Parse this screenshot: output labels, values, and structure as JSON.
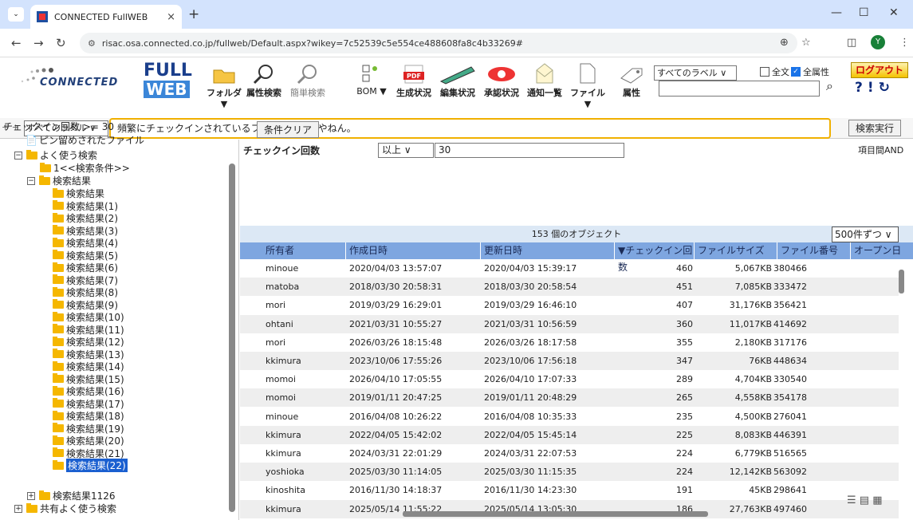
{
  "browser": {
    "tab_title": "CONNECTED FullWEB",
    "tab_close": "×",
    "new_tab": "+",
    "url": "risac.osa.connected.co.jp/fullweb/Default.aspx?wikey=7c52539c5e554ce488608fa8c4b33269#",
    "profile_initial": "Y"
  },
  "logo": {
    "brand": "CONNECTED",
    "full": "FULL",
    "web": "WEB"
  },
  "toolbar": {
    "folder": "フォルダ▼",
    "attr_search": "属性検索",
    "simple_search": "簡単検索",
    "bom": "BOM ▼",
    "gen_status": "生成状況",
    "edit_status": "編集状況",
    "approve_status": "承認状況",
    "notify_list": "通知一覧",
    "file": "ファイル ▼",
    "attr": "属性",
    "label_select": "すべてのラベル ∨",
    "fulltext": "全文",
    "all_attr": "全属性",
    "logout": "ログアウト"
  },
  "query": {
    "plus": "+ +",
    "label_select": "すべてのラベル ∨",
    "text": "頻繁にチェックインされているファイルはどれやねん。"
  },
  "left": {
    "criteria": "チェックイン回数 >= 30",
    "pinned": "ピン留めされたファイル",
    "favorites": "よく使う検索",
    "search_cond": "1<<検索条件>>",
    "results_root": "検索結果",
    "results": [
      "検索結果",
      "検索結果(1)",
      "検索結果(2)",
      "検索結果(3)",
      "検索結果(4)",
      "検索結果(5)",
      "検索結果(6)",
      "検索結果(7)",
      "検索結果(8)",
      "検索結果(9)",
      "検索結果(10)",
      "検索結果(11)",
      "検索結果(12)",
      "検索結果(13)",
      "検索結果(14)",
      "検索結果(15)",
      "検索結果(16)",
      "検索結果(17)",
      "検索結果(18)",
      "検索結果(19)",
      "検索結果(20)",
      "検索結果(21)",
      "検索結果(22)"
    ],
    "results1126": "検索結果1126",
    "shared": "共有よく使う検索"
  },
  "conditions": {
    "clear": "条件クリア",
    "execute": "検索実行",
    "label": "チェックイン回数",
    "operator": "以上 ∨",
    "value": "30",
    "and_label": "項目間AND"
  },
  "table": {
    "object_count": "153 個のオブジェクト",
    "per_page": "500件ずつ ∨",
    "headers": [
      "所有者",
      "作成日時",
      "更新日時",
      "▼チェックイン回数",
      "ファイルサイズ",
      "ファイル番号",
      "オープン日"
    ],
    "rows": [
      [
        "minoue",
        "2020/04/03 13:57:07",
        "2020/04/03 15:39:17",
        "460",
        "5,067KB",
        "380466"
      ],
      [
        "matoba",
        "2018/03/30 20:58:31",
        "2018/03/30 20:58:54",
        "451",
        "7,085KB",
        "333472"
      ],
      [
        "mori",
        "2019/03/29 16:29:01",
        "2019/03/29 16:46:10",
        "407",
        "31,176KB",
        "356421"
      ],
      [
        "ohtani",
        "2021/03/31 10:55:27",
        "2021/03/31 10:56:59",
        "360",
        "11,017KB",
        "414692"
      ],
      [
        "mori",
        "2026/03/26 18:15:48",
        "2026/03/26 18:17:58",
        "355",
        "2,180KB",
        "317176"
      ],
      [
        "kkimura",
        "2023/10/06 17:55:26",
        "2023/10/06 17:56:18",
        "347",
        "76KB",
        "448634"
      ],
      [
        "momoi",
        "2026/04/10 17:05:55",
        "2026/04/10 17:07:33",
        "289",
        "4,704KB",
        "330540"
      ],
      [
        "momoi",
        "2019/01/11 20:47:25",
        "2019/01/11 20:48:29",
        "265",
        "4,558KB",
        "354178"
      ],
      [
        "minoue",
        "2016/04/08 10:26:22",
        "2016/04/08 10:35:33",
        "235",
        "4,500KB",
        "276041"
      ],
      [
        "kkimura",
        "2022/04/05 15:42:02",
        "2022/04/05 15:45:14",
        "225",
        "8,083KB",
        "446391"
      ],
      [
        "kkimura",
        "2024/03/31 22:01:29",
        "2024/03/31 22:07:53",
        "224",
        "6,779KB",
        "516565"
      ],
      [
        "yoshioka",
        "2025/03/30 11:14:05",
        "2025/03/30 11:15:35",
        "224",
        "12,142KB",
        "563092"
      ],
      [
        "kinoshita",
        "2016/11/30 14:18:37",
        "2016/11/30 14:23:30",
        "191",
        "45KB",
        "298641"
      ],
      [
        "kkimura",
        "2025/05/14 11:55:22",
        "2025/05/14 13:05:30",
        "186",
        "27,763KB",
        "497460"
      ]
    ]
  }
}
